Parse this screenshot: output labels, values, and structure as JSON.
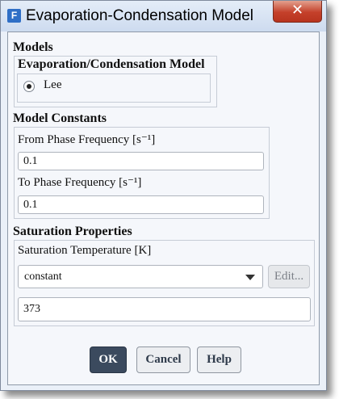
{
  "window": {
    "title": "Evaporation-Condensation Model",
    "icon_letter": "F",
    "close_glyph": "✕"
  },
  "models": {
    "group_title": "Models",
    "subgroup_title": "Evaporation/Condensation Model",
    "options": [
      {
        "label": "Lee",
        "selected": true
      }
    ]
  },
  "constants": {
    "group_title": "Model Constants",
    "from_label": "From Phase Frequency [s⁻¹]",
    "from_value": "0.1",
    "to_label": "To Phase Frequency [s⁻¹]",
    "to_value": "0.1"
  },
  "saturation": {
    "group_title": "Saturation Properties",
    "temp_label": "Saturation Temperature [K]",
    "method_value": "constant",
    "edit_label": "Edit...",
    "temp_value": "373"
  },
  "buttons": {
    "ok": "OK",
    "cancel": "Cancel",
    "help": "Help"
  },
  "colors": {
    "title_bar": "#cddbef",
    "close_button": "#c4402a",
    "primary_button": "#3b4a5e"
  }
}
